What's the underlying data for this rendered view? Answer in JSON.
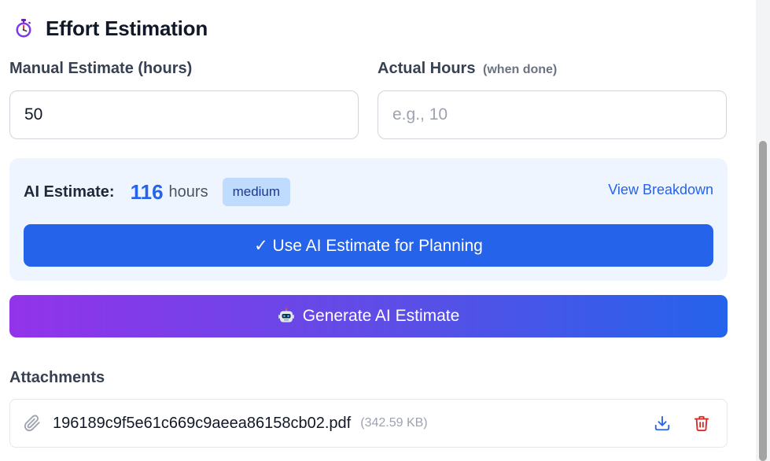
{
  "section": {
    "title": "Effort Estimation",
    "icon": "stopwatch-icon"
  },
  "manual_estimate": {
    "label": "Manual Estimate (hours)",
    "value": "50",
    "placeholder": ""
  },
  "actual_hours": {
    "label": "Actual Hours",
    "hint": "(when done)",
    "value": "",
    "placeholder": "e.g., 10"
  },
  "ai_estimate": {
    "label": "AI Estimate:",
    "value": "116",
    "unit": "hours",
    "confidence": "medium",
    "view_breakdown_label": "View Breakdown",
    "use_button_label": "✓ Use AI Estimate for Planning"
  },
  "generate_button": {
    "label": "Generate AI Estimate",
    "icon": "robot-icon"
  },
  "attachments": {
    "title": "Attachments",
    "items": [
      {
        "name": "196189c9f5e61c669c9aeea86158cb02.pdf",
        "size": "(342.59 KB)"
      }
    ]
  },
  "colors": {
    "primary": "#2563eb",
    "panel_bg": "#eef5fe",
    "badge_bg": "#bfdbfe",
    "gradient_start": "#9333ea",
    "gradient_end": "#2563eb",
    "delete": "#dc2626"
  }
}
